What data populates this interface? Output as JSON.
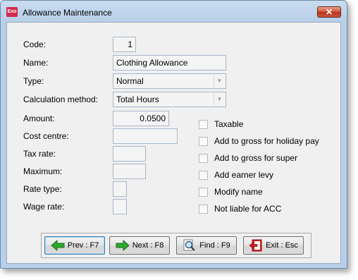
{
  "window": {
    "title": "Allowance Maintenance",
    "app_icon_text": "Exo",
    "close_glyph": "✕"
  },
  "form": {
    "code": {
      "label": "Code:",
      "value": "1"
    },
    "name": {
      "label": "Name:",
      "value": "Clothing Allowance"
    },
    "type": {
      "label": "Type:",
      "value": "Normal"
    },
    "calc": {
      "label": "Calculation method:",
      "value": "Total Hours"
    },
    "amount": {
      "label": "Amount:",
      "value": "0.0500"
    },
    "cost_centre": {
      "label": "Cost centre:",
      "value": ""
    },
    "tax_rate": {
      "label": "Tax rate:",
      "value": ""
    },
    "maximum": {
      "label": "Maximum:",
      "value": ""
    },
    "rate_type": {
      "label": "Rate type:",
      "value": ""
    },
    "wage_rate": {
      "label": "Wage rate:",
      "value": ""
    }
  },
  "checkboxes": [
    {
      "label": "Taxable",
      "checked": false
    },
    {
      "label": "Add to gross for holiday pay",
      "checked": false
    },
    {
      "label": "Add to gross for super",
      "checked": false
    },
    {
      "label": "Add earner levy",
      "checked": false
    },
    {
      "label": "Modify name",
      "checked": false
    },
    {
      "label": "Not liable for ACC",
      "checked": false
    }
  ],
  "buttons": {
    "prev": "Prev : F7",
    "next": "Next : F8",
    "find": "Find : F9",
    "exit": "Exit : Esc"
  },
  "icons": {
    "prev": "arrow-left-icon",
    "next": "arrow-right-icon",
    "find": "magnifier-icon",
    "exit": "exit-door-icon"
  },
  "colors": {
    "title_bar": "#b7cfe8",
    "close_button": "#c8563d",
    "arrow_green": "#2fa82f",
    "exit_red": "#d42020"
  }
}
